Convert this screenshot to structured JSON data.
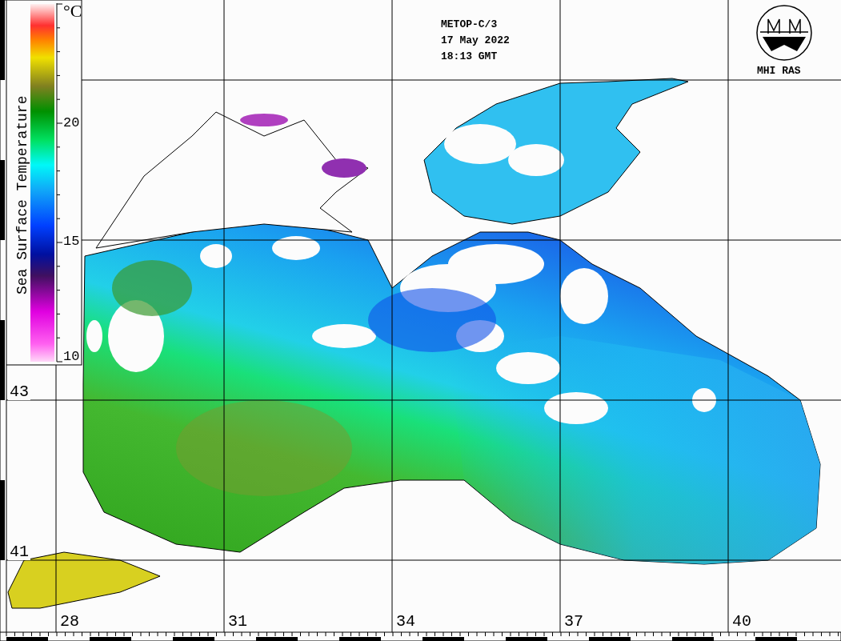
{
  "header": {
    "lines": [
      "METOP-C/3",
      "17 May 2022",
      "18:13 GMT"
    ]
  },
  "logo": {
    "text": "MHI RAS"
  },
  "legend": {
    "title": "Sea Surface Temperature",
    "unit": "°C",
    "ticks": [
      "20",
      "15",
      "10"
    ]
  },
  "grid": {
    "latitudes": [
      "43",
      "41"
    ],
    "longitudes": [
      "28",
      "31",
      "34",
      "37",
      "40"
    ]
  }
}
